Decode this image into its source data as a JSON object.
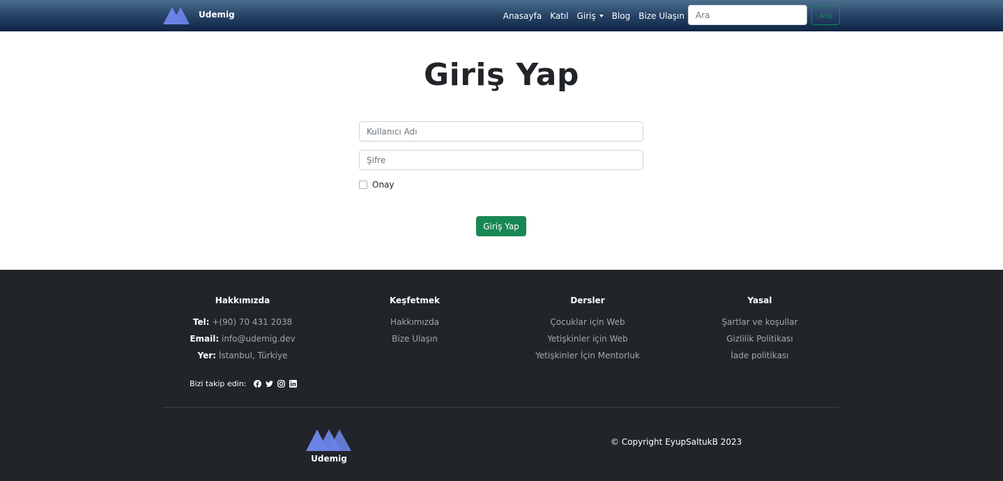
{
  "brand": {
    "name": "Udemig",
    "logo_color": "#6b83e4"
  },
  "nav": {
    "links": [
      "Anasayfa",
      "Katıl",
      "Giriş",
      "Blog",
      "Bize Ulaşın"
    ],
    "search_placeholder": "Ara",
    "search_button": "Ara"
  },
  "login": {
    "title": "Giriş Yap",
    "username_placeholder": "Kullanıcı Adı",
    "password_placeholder": "Şifre",
    "checkbox_label": "Onay",
    "submit_label": "Giriş Yap"
  },
  "footer": {
    "about": {
      "title": "Hakkımızda",
      "tel_label": "Tel:",
      "tel": "+(90) 70 431 2038",
      "email_label": "Email:",
      "email": "info@udemig.dev",
      "location_label": "Yer:",
      "location": "İstanbul, Türkiye"
    },
    "explore": {
      "title": "Keşfetmek",
      "items": [
        "Hakkımızda",
        "Bize Ulaşın"
      ]
    },
    "courses": {
      "title": "Dersler",
      "items": [
        "Çocuklar için Web",
        "Yetişkinler için Web",
        "Yetişkinler İçin Mentorluk"
      ]
    },
    "legal": {
      "title": "Yasal",
      "items": [
        "Şartlar ve koşullar",
        "Gizlilik Politikası",
        "İade politikası"
      ]
    },
    "follow_text": "Bizi takip edin:",
    "social_icons": [
      "facebook-icon",
      "twitter-icon",
      "instagram-icon",
      "linkedin-icon"
    ],
    "logo_name": "Udemig",
    "copyright": "© Copyright EyupSaltukB 2023"
  },
  "colors": {
    "primary_green": "#198754",
    "footer_bg": "#212529",
    "nav_dark": "#0e2444"
  }
}
